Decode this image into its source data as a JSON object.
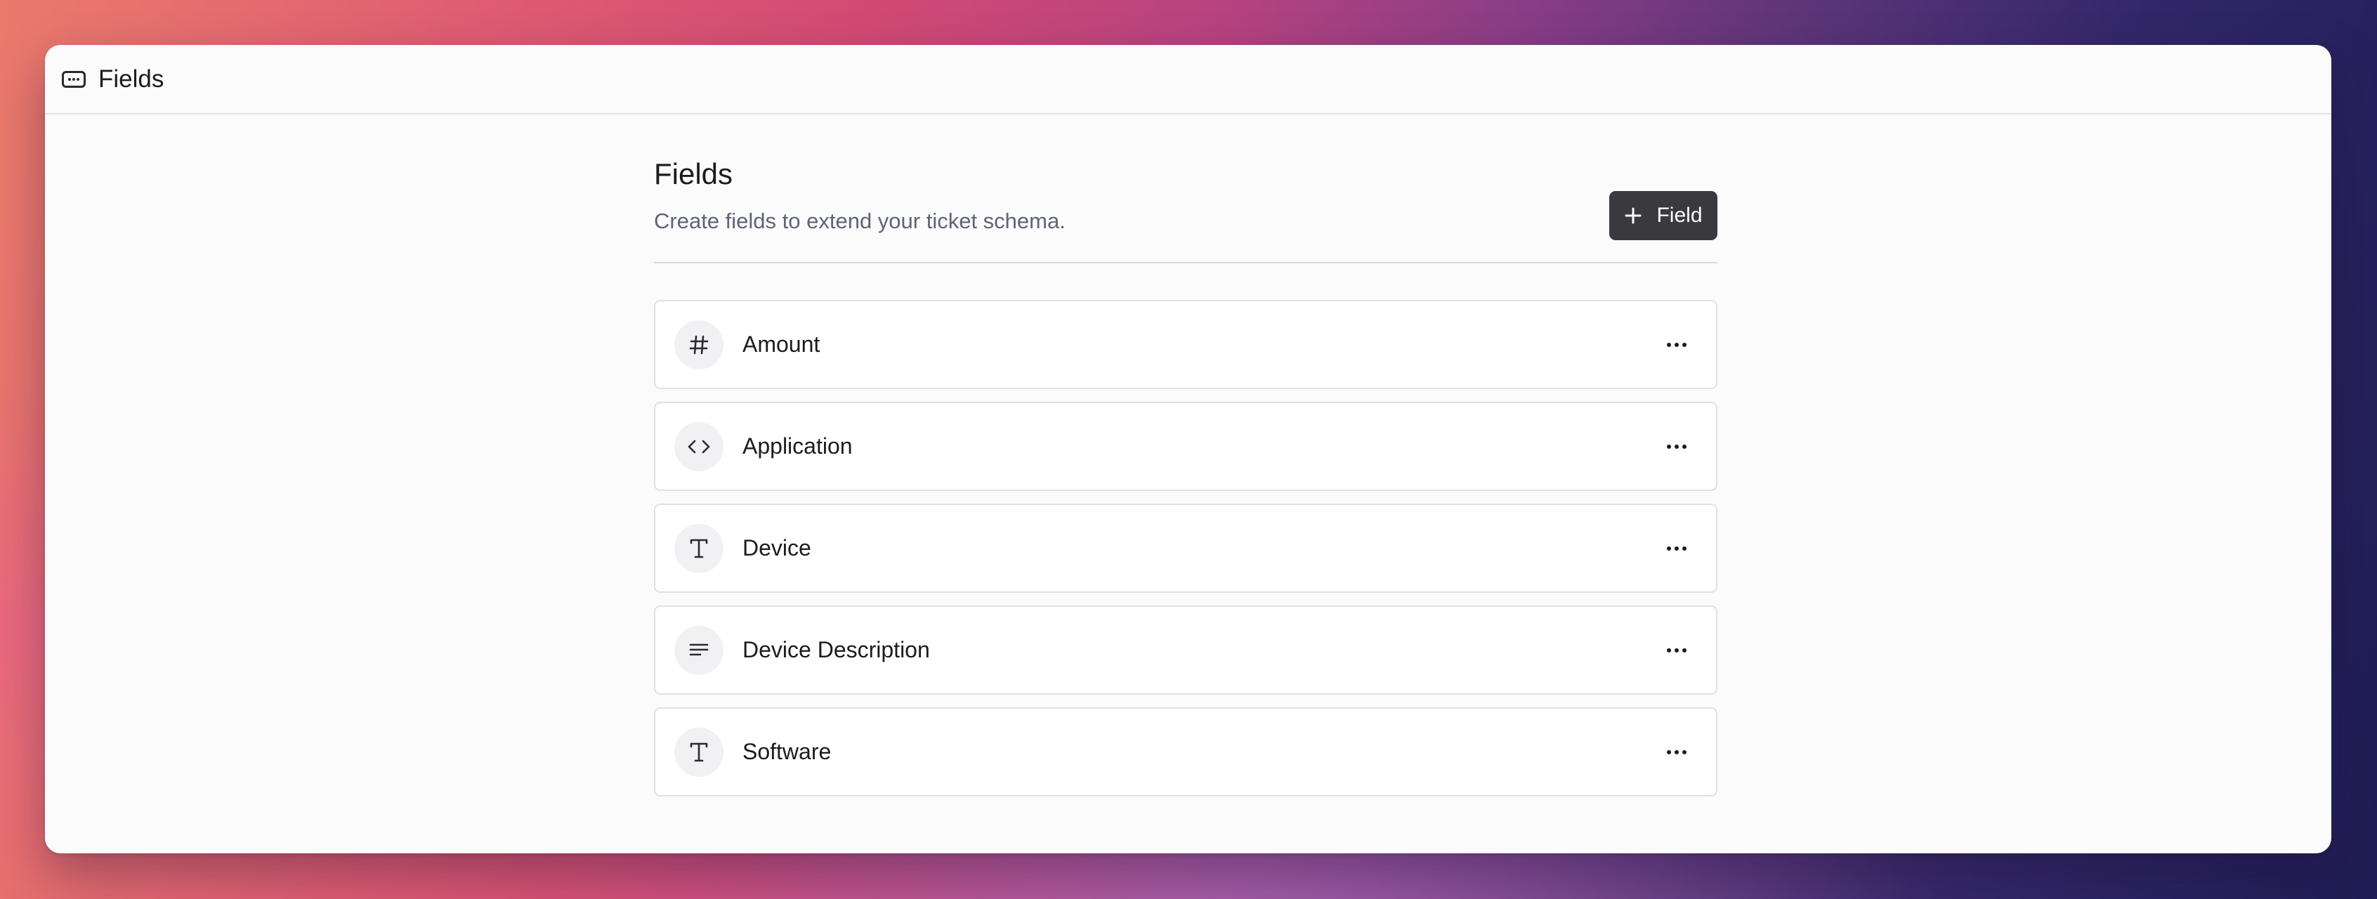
{
  "window": {
    "title": "Fields",
    "icon": "form-field-icon"
  },
  "page": {
    "title": "Fields",
    "subtitle": "Create fields to extend your ticket schema.",
    "add_button_label": "Field",
    "add_button_icon": "plus-icon"
  },
  "fields": [
    {
      "label": "Amount",
      "icon": "hash-icon"
    },
    {
      "label": "Application",
      "icon": "code-icon"
    },
    {
      "label": "Device",
      "icon": "text-type-icon"
    },
    {
      "label": "Device Description",
      "icon": "paragraph-icon"
    },
    {
      "label": "Software",
      "icon": "text-type-icon"
    }
  ],
  "colors": {
    "button_bg": "#3a3a3e",
    "subtitle": "#5e6478",
    "window_bg": "#fbfbfb"
  }
}
